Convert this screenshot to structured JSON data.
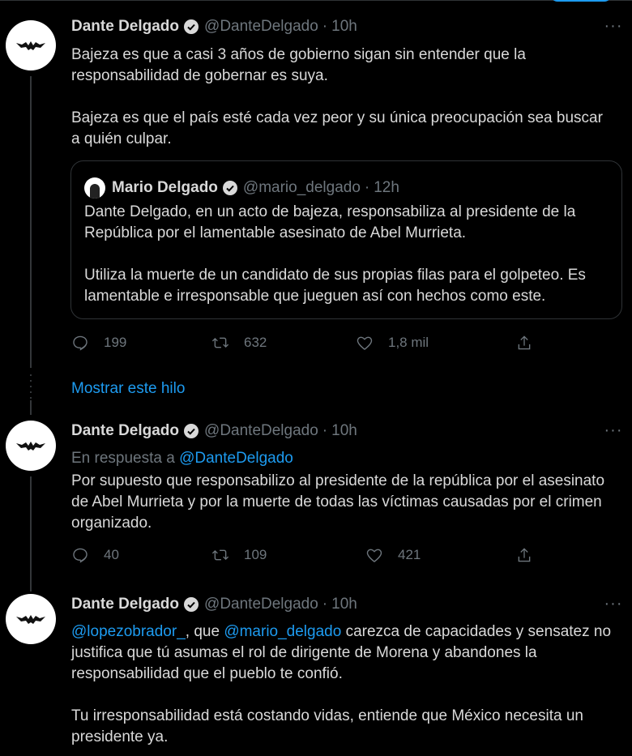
{
  "tweets": [
    {
      "author": "Dante Delgado",
      "handle": "@DanteDelgado",
      "time": "10h",
      "text": [
        "Bajeza es que a casi 3 años de gobierno sigan sin entender que la responsabilidad de gobernar es suya.",
        "Bajeza es que el país esté cada vez peor y su única preocupación sea buscar a quién culpar."
      ],
      "quote": {
        "author": "Mario Delgado",
        "handle": "@mario_delgado",
        "time": "12h",
        "text": [
          "Dante Delgado, en un acto de bajeza, responsabiliza al presidente de la República por el lamentable asesinato de Abel Murrieta.",
          "Utiliza la muerte de un candidato de sus propias filas para el golpeteo. Es lamentable e irresponsable que jueguen así con hechos como este."
        ]
      },
      "replies": "199",
      "retweets": "632",
      "likes": "1,8 mil"
    },
    {
      "author": "Dante Delgado",
      "handle": "@DanteDelgado",
      "time": "10h",
      "reply_prefix": "En respuesta a",
      "reply_to": "@DanteDelgado",
      "text": [
        "Por supuesto que responsabilizo al presidente de la república por el asesinato de Abel Murrieta y por la muerte de todas las víctimas causadas por el crimen organizado."
      ],
      "replies": "40",
      "retweets": "109",
      "likes": "421"
    },
    {
      "author": "Dante Delgado",
      "handle": "@DanteDelgado",
      "time": "10h",
      "mention1": "@lopezobrador_",
      "text_part1": ", que ",
      "mention2": "@mario_delgado",
      "text_part2": " carezca de capacidades y sensatez no justifica que tú asumas el rol de dirigente de Morena y abandones la responsabilidad que el pueblo te confió.",
      "text2": "Tu irresponsabilidad está costando vidas, entiende que México necesita un presidente ya."
    }
  ],
  "show_thread": "Mostrar este hilo",
  "separator": "·",
  "more_glyph": "···",
  "colors": {
    "accent": "#1d9bf0",
    "muted": "#6e767d",
    "text": "#d9d9d9",
    "background": "#000000"
  }
}
